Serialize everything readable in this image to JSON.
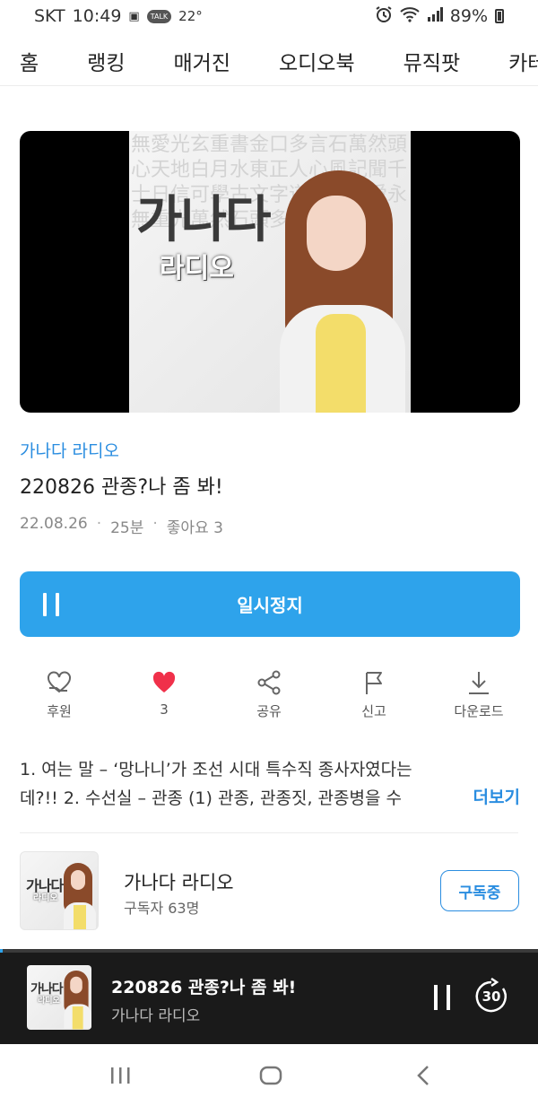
{
  "status_bar": {
    "carrier": "SKT",
    "time": "10:49",
    "talk_badge": "TALK",
    "temperature": "22°",
    "battery": "89%"
  },
  "top_nav": {
    "tabs": [
      "홈",
      "랭킹",
      "매거진",
      "오디오북",
      "뮤직팟",
      "카테고리"
    ]
  },
  "cover": {
    "logo_main": "가나다",
    "logo_sub": "라디오",
    "hanja_pattern": "無愛光玄重書金口多言石萬然頭心天地白月水東正人心風記聞千士日信可學古文字道佛明國愛永無重光萬然石頭多言"
  },
  "episode": {
    "channel_link": "가나다 라디오",
    "title": "220826 관종?나 좀 봐!",
    "date": "22.08.26",
    "duration": "25분",
    "likes_text": "좋아요 3"
  },
  "pause_button": {
    "label": "일시정지"
  },
  "actions": {
    "donate": "후원",
    "like_count": "3",
    "share": "공유",
    "report": "신고",
    "download": "다운로드"
  },
  "description": {
    "line1": "1. 여는 말 – ‘망나니’가 조선 시대 특수직 종사자였다는",
    "line2": "데?!! 2. 수선실 – 관종 (1) 관종, 관종짓, 관종병을 수",
    "more_label": "더보기"
  },
  "channel_card": {
    "name": "가나다 라디오",
    "subscribers": "구독자 63명",
    "subscribe_label": "구독중",
    "thumb_logo": "가나다",
    "thumb_sub": "라디오"
  },
  "mini_player": {
    "title": "220826 관종?나 좀 봐!",
    "channel": "가나다 라디오",
    "forward_seconds": "30",
    "progress": 0.005
  },
  "colors": {
    "accent": "#2ea3eb",
    "link": "#2a8de0",
    "heart": "#f0304a",
    "player_bg": "#1a1a1a"
  },
  "icons": {
    "donate": "heart-hand-icon",
    "like": "heart-icon",
    "share": "share-icon",
    "report": "flag-icon",
    "download": "download-icon"
  }
}
